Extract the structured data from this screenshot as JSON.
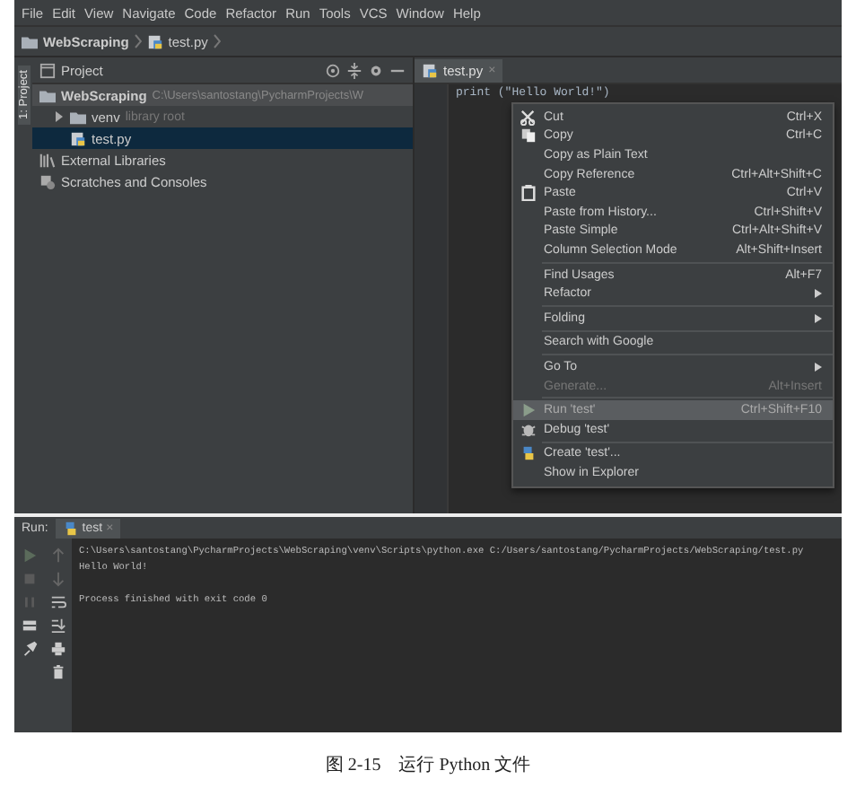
{
  "menubar": [
    "File",
    "Edit",
    "View",
    "Navigate",
    "Code",
    "Refactor",
    "Run",
    "Tools",
    "VCS",
    "Window",
    "Help"
  ],
  "breadcrumb": [
    "WebScraping",
    "test.py"
  ],
  "tool_strip": {
    "label": "1: Project"
  },
  "project": {
    "title": "Project",
    "tree": [
      {
        "kind": "folder",
        "label": "WebScraping",
        "path": "C:\\Users\\santostang\\PycharmProjects\\W",
        "selected": false,
        "children": [
          {
            "kind": "folder",
            "label": "venv",
            "hint": "library root",
            "expanded": false,
            "selected": false
          },
          {
            "kind": "file",
            "label": "test.py",
            "selected": true
          }
        ]
      },
      {
        "kind": "library",
        "label": "External Libraries",
        "selected": false
      },
      {
        "kind": "scratches",
        "label": "Scratches and Consoles",
        "selected": false
      }
    ]
  },
  "editor": {
    "tab": {
      "label": "test.py",
      "close": "×"
    },
    "code": "print (\"Hello World!\")"
  },
  "context_menu": [
    {
      "kind": "item",
      "label": "Cut",
      "shortcut": "Ctrl+X",
      "disabled": false,
      "selected": false
    },
    {
      "kind": "item",
      "label": "Copy",
      "shortcut": "Ctrl+C",
      "disabled": false,
      "selected": false
    },
    {
      "kind": "item",
      "label": "Copy as Plain Text",
      "disabled": false,
      "selected": false
    },
    {
      "kind": "item",
      "label": "Copy Reference",
      "shortcut": "Ctrl+Alt+Shift+C",
      "disabled": false,
      "selected": false
    },
    {
      "kind": "item",
      "label": "Paste",
      "shortcut": "Ctrl+V",
      "disabled": false,
      "selected": false
    },
    {
      "kind": "item",
      "label": "Paste from History...",
      "shortcut": "Ctrl+Shift+V",
      "disabled": false,
      "selected": false
    },
    {
      "kind": "item",
      "label": "Paste Simple",
      "shortcut": "Ctrl+Alt+Shift+V",
      "disabled": false,
      "selected": false
    },
    {
      "kind": "item",
      "label": "Column Selection Mode",
      "shortcut": "Alt+Shift+Insert",
      "disabled": false,
      "selected": false
    },
    {
      "kind": "separator"
    },
    {
      "kind": "item",
      "label": "Find Usages",
      "shortcut": "Alt+F7",
      "disabled": false,
      "selected": false
    },
    {
      "kind": "item",
      "label": "Refactor",
      "submenu": true,
      "disabled": false,
      "selected": false
    },
    {
      "kind": "separator"
    },
    {
      "kind": "item",
      "label": "Folding",
      "submenu": true,
      "disabled": false,
      "selected": false
    },
    {
      "kind": "separator"
    },
    {
      "kind": "item",
      "label": "Search with Google",
      "disabled": false,
      "selected": false
    },
    {
      "kind": "separator"
    },
    {
      "kind": "item",
      "label": "Go To",
      "submenu": true,
      "disabled": false,
      "selected": false
    },
    {
      "kind": "item",
      "label": "Generate...",
      "shortcut": "Alt+Insert",
      "disabled": true,
      "selected": false
    },
    {
      "kind": "separator"
    },
    {
      "kind": "item",
      "label": "Run 'test'",
      "shortcut": "Ctrl+Shift+F10",
      "disabled": false,
      "selected": true
    },
    {
      "kind": "item",
      "label": "Debug 'test'",
      "disabled": false,
      "selected": false
    },
    {
      "kind": "separator"
    },
    {
      "kind": "item",
      "label": "Create 'test'...",
      "disabled": false,
      "selected": false
    },
    {
      "kind": "item",
      "label": "Show in Explorer",
      "disabled": false,
      "selected": false
    }
  ],
  "run": {
    "label": "Run:",
    "tab": {
      "label": "test",
      "close": "×"
    },
    "output": [
      "C:\\Users\\santostang\\PycharmProjects\\WebScraping\\venv\\Scripts\\python.exe C:/Users/santostang/PycharmProjects/WebScraping/test.py",
      "Hello World!",
      "Process finished with exit code 0"
    ]
  },
  "caption": "图 2-15　运行 Python 文件"
}
